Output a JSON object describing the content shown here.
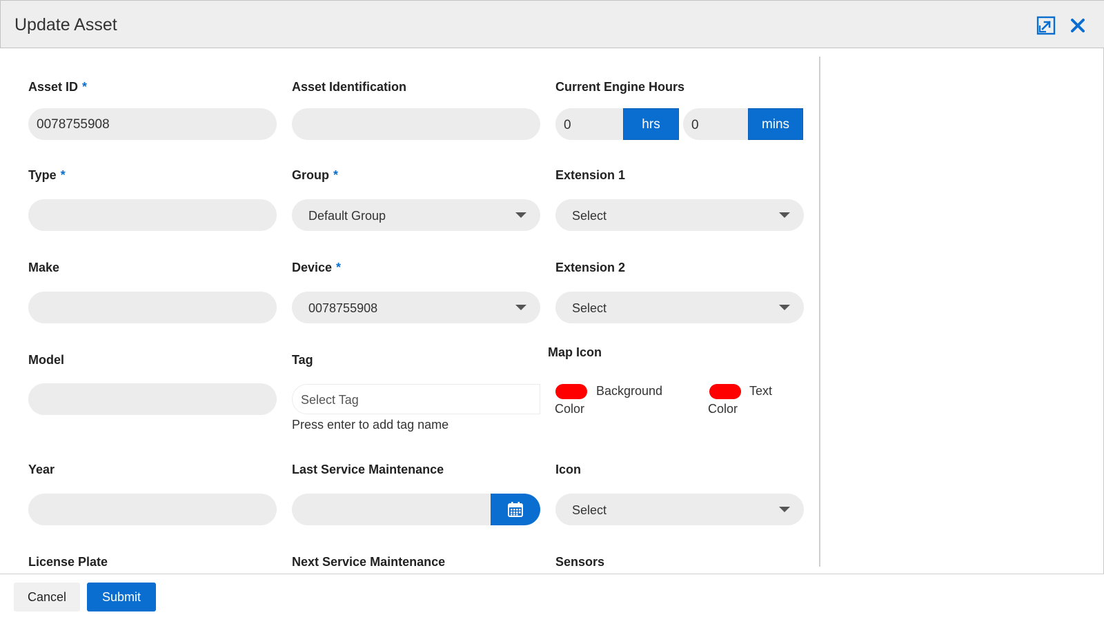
{
  "modal": {
    "title": "Update Asset"
  },
  "colors": {
    "accent": "#0a6ed1",
    "swatch": "#ff0000",
    "field_bg": "#ececec"
  },
  "icons": {
    "expand": "expand-icon",
    "close": "close-icon",
    "calendar": "calendar-icon",
    "caret": "chevron-down-icon"
  },
  "form": {
    "asset_id": {
      "label": "Asset ID",
      "required": "*",
      "value": "0078755908"
    },
    "asset_identification": {
      "label": "Asset Identification",
      "value": ""
    },
    "engine_hours": {
      "label": "Current Engine Hours",
      "hours_value": "0",
      "hours_unit": "hrs",
      "mins_value": "0",
      "mins_unit": "mins"
    },
    "type": {
      "label": "Type",
      "required": "*",
      "value": ""
    },
    "group": {
      "label": "Group",
      "required": "*",
      "value": "Default Group"
    },
    "extension1": {
      "label": "Extension 1",
      "value": "Select"
    },
    "make": {
      "label": "Make",
      "value": ""
    },
    "device": {
      "label": "Device",
      "required": "*",
      "value": "0078755908"
    },
    "extension2": {
      "label": "Extension 2",
      "value": "Select"
    },
    "model": {
      "label": "Model",
      "value": ""
    },
    "tag": {
      "label": "Tag",
      "placeholder": "Select Tag",
      "hint": "Press enter to add tag name"
    },
    "map_icon": {
      "label": "Map Icon",
      "background_label_1": "Background",
      "background_label_2": "Color",
      "text_label_1": "Text",
      "text_label_2": "Color"
    },
    "year": {
      "label": "Year",
      "value": ""
    },
    "last_service": {
      "label": "Last Service Maintenance",
      "value": ""
    },
    "icon": {
      "label": "Icon",
      "value": "Select"
    },
    "license_plate": {
      "label": "License Plate"
    },
    "next_service": {
      "label": "Next Service Maintenance"
    },
    "sensors": {
      "label": "Sensors"
    }
  },
  "footer": {
    "cancel_label": "Cancel",
    "submit_label": "Submit"
  }
}
